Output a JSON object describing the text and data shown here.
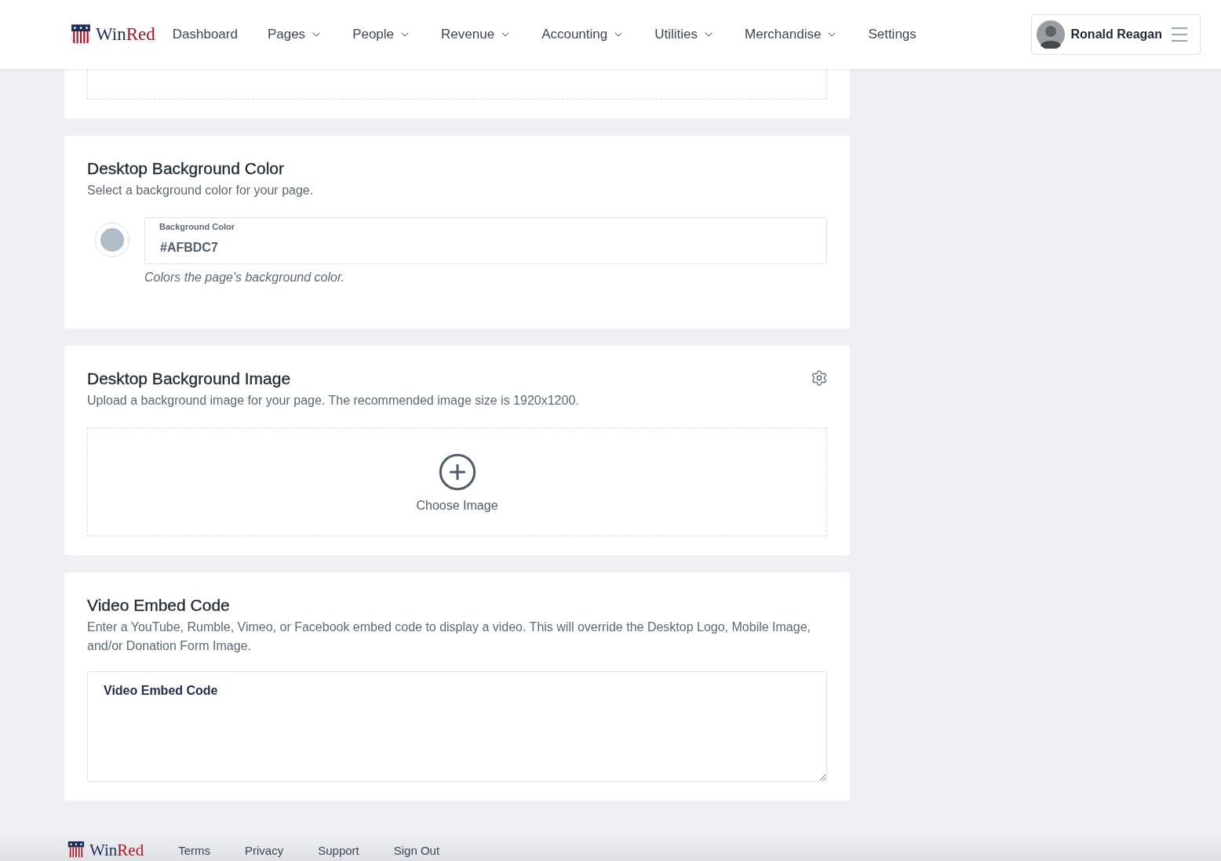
{
  "header": {
    "brand_primary": "Win",
    "brand_accent": "Red",
    "nav": [
      {
        "label": "Dashboard",
        "dropdown": false
      },
      {
        "label": "Pages",
        "dropdown": true
      },
      {
        "label": "People",
        "dropdown": true
      },
      {
        "label": "Revenue",
        "dropdown": true
      },
      {
        "label": "Accounting",
        "dropdown": true
      },
      {
        "label": "Utilities",
        "dropdown": true
      },
      {
        "label": "Merchandise",
        "dropdown": true
      },
      {
        "label": "Settings",
        "dropdown": false
      }
    ],
    "user": {
      "name": "Ronald Reagan"
    }
  },
  "sections": [
    {
      "kind": "color",
      "title": "Desktop Background Color",
      "description": "Select a background color for your page.",
      "field_label": "Background Color",
      "value": "#AFBDC7",
      "hint": "Colors the page's background color."
    },
    {
      "kind": "image",
      "title": "Desktop Background Image",
      "description": "Upload a background image for your page. The recommended image size is 1920x1200.",
      "button": "Choose Image",
      "settings": true
    },
    {
      "kind": "video",
      "title": "Video Embed Code",
      "description": "Enter a YouTube, Rumble, Vimeo, or Facebook embed code to display a video. This will override the Desktop Logo, Mobile Image, and/or Donation Form Image.",
      "field_label": "Video Embed Code"
    }
  ],
  "footer": {
    "brand_primary": "Win",
    "brand_accent": "Red",
    "links": [
      "Terms",
      "Privacy",
      "Support",
      "Sign Out"
    ]
  }
}
